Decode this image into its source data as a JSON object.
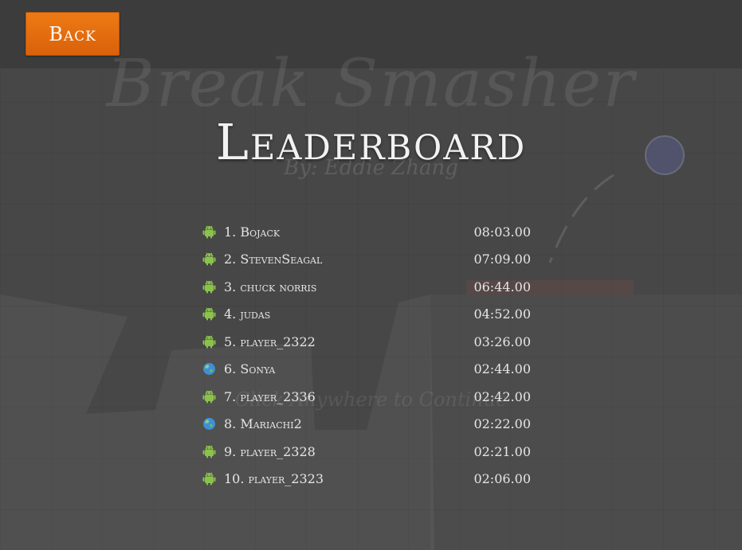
{
  "background": {
    "game_title": "Break Smasher",
    "author": "By: Eddie Zhang",
    "hint": "Click Anywhere to Continue"
  },
  "header": {
    "back_label": "Back"
  },
  "page_title": "Leaderboard",
  "colors": {
    "accent": "#e46f0e",
    "android": "#8bc34a",
    "earth": "#3e8fd6"
  },
  "leaderboard": [
    {
      "label": "1. Bojack",
      "time": "08:03.00",
      "icon": "android-icon"
    },
    {
      "label": "2. StevenSeagal",
      "time": "07:09.00",
      "icon": "android-icon"
    },
    {
      "label": "3. chuck norris",
      "time": "06:44.00",
      "icon": "android-icon"
    },
    {
      "label": "4. judas",
      "time": "04:52.00",
      "icon": "android-icon"
    },
    {
      "label": "5. player_2322",
      "time": "03:26.00",
      "icon": "android-icon"
    },
    {
      "label": "6. Sonya",
      "time": "02:44.00",
      "icon": "globe-icon"
    },
    {
      "label": "7. player_2336",
      "time": "02:42.00",
      "icon": "android-icon"
    },
    {
      "label": "8. Mariachi2",
      "time": "02:22.00",
      "icon": "globe-icon"
    },
    {
      "label": "9. player_2328",
      "time": "02:21.00",
      "icon": "android-icon"
    },
    {
      "label": "10. player_2323",
      "time": "02:06.00",
      "icon": "android-icon"
    }
  ]
}
